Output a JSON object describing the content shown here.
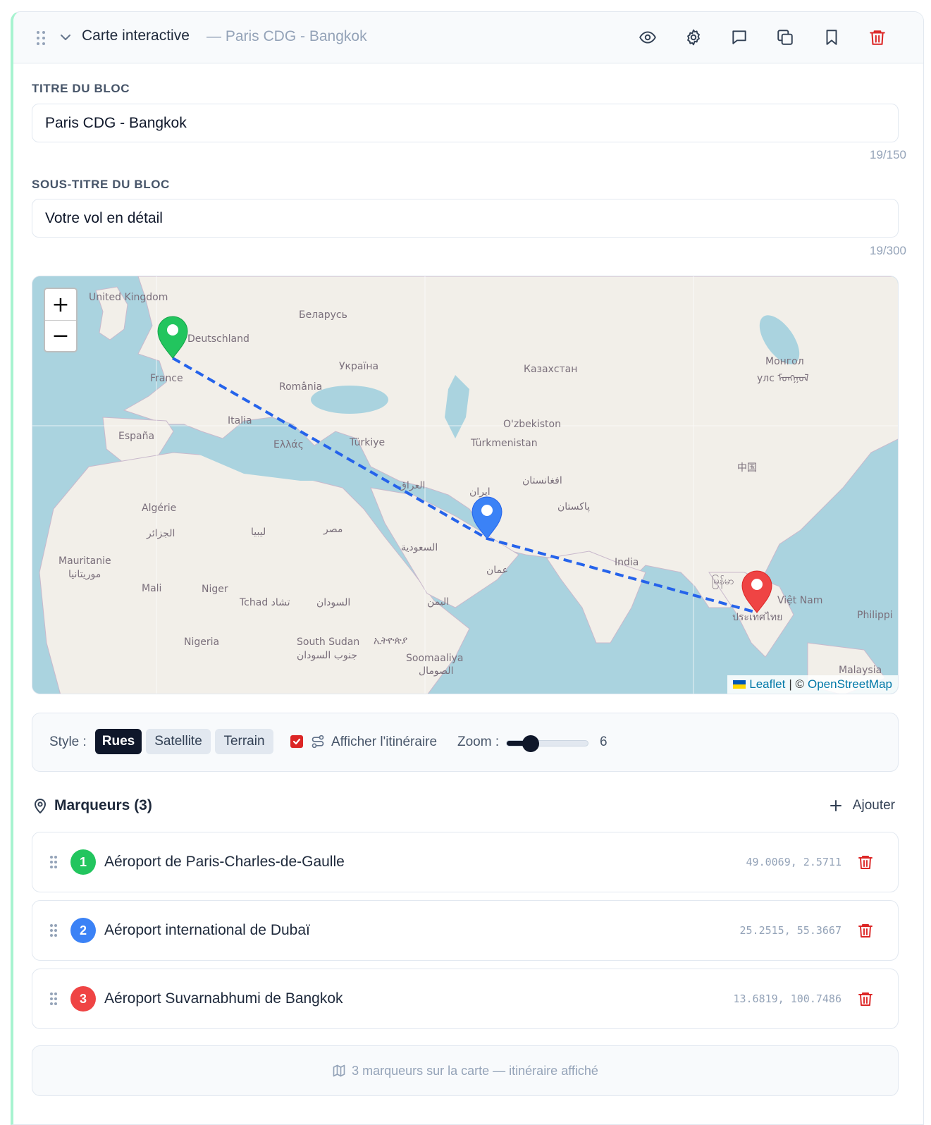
{
  "header": {
    "title": "Carte interactive",
    "subtitle": "— Paris CDG - Bangkok",
    "icons": [
      "eye-icon",
      "gear-icon",
      "comment-icon",
      "copy-icon",
      "bookmark-icon",
      "trash-icon"
    ]
  },
  "block_title": {
    "label": "TITRE DU BLOC",
    "value": "Paris CDG - Bangkok",
    "counter": "19/150"
  },
  "block_subtitle": {
    "label": "SOUS-TITRE DU BLOC",
    "value": "Votre vol en détail",
    "counter": "19/300"
  },
  "map": {
    "zoom_in": "+",
    "zoom_out": "−",
    "attribution_leaflet": "Leaflet",
    "attribution_sep": "| ©",
    "attribution_osm": "OpenStreetMap",
    "labels": {
      "uk": "United Kingdom",
      "de": "Deutschland",
      "fr": "France",
      "es": "España",
      "it": "Italia",
      "by": "Беларусь",
      "ua": "Україна",
      "ro": "România",
      "gr": "Ελλάς",
      "tr": "Türkiye",
      "kz": "Казахстан",
      "uz": "O'zbekiston",
      "tm": "Türkmenistan",
      "mn": "Монгол",
      "mn2": "улс ᠮᠣᠩᠭᠣᠯ",
      "cn": "中国",
      "ir": "ایران",
      "iq": "العراق",
      "af": "افغانستان",
      "pk": "پاکستان",
      "in": "India",
      "om": "عمان",
      "sa": "السعودية",
      "ye": "اليمن",
      "eg": "مصر",
      "ly": "ليبيا",
      "dz": "Algérie",
      "dz2": "الجزائر",
      "mr": "Mauritanie",
      "mr2": "موريتانيا",
      "ml": "Mali",
      "ne": "Niger",
      "td": "Tchad تشاد",
      "sd": "السودان",
      "ng": "Nigeria",
      "ss": "South Sudan",
      "ss2": "جنوب السودان",
      "et": "ኢትዮጵያ",
      "so": "Soomaaliya",
      "so2": "الصومال",
      "mm": "မြန်မာ",
      "th": "ประเทศไทย",
      "vn": "Việt Nam",
      "ph": "Philippi",
      "my": "Malaysia"
    }
  },
  "toolbar": {
    "style_label": "Style :",
    "styles": [
      "Rues",
      "Satellite",
      "Terrain"
    ],
    "active_style": "Rues",
    "show_route_label": "Afficher l'itinéraire",
    "show_route_checked": true,
    "zoom_label": "Zoom :",
    "zoom_value": "6",
    "zoom_min": 1,
    "zoom_max": 18
  },
  "markers_section": {
    "title": "Marqueurs (3)",
    "add_label": "Ajouter"
  },
  "markers": [
    {
      "index": "1",
      "name": "Aéroport de Paris-Charles-de-Gaulle",
      "coords": "49.0069, 2.5711",
      "color": "#22c55e"
    },
    {
      "index": "2",
      "name": "Aéroport international de Dubaï",
      "coords": "25.2515, 55.3667",
      "color": "#3b82f6"
    },
    {
      "index": "3",
      "name": "Aéroport Suvarnabhumi de Bangkok",
      "coords": "13.6819, 100.7486",
      "color": "#ef4444"
    }
  ],
  "footer": {
    "summary": "3 marqueurs sur la carte — itinéraire affiché"
  },
  "colors": {
    "accent": "#0f172a",
    "danger": "#dc2626",
    "route": "#2563eb",
    "sea": "#aad3df",
    "land": "#f2efe9"
  }
}
